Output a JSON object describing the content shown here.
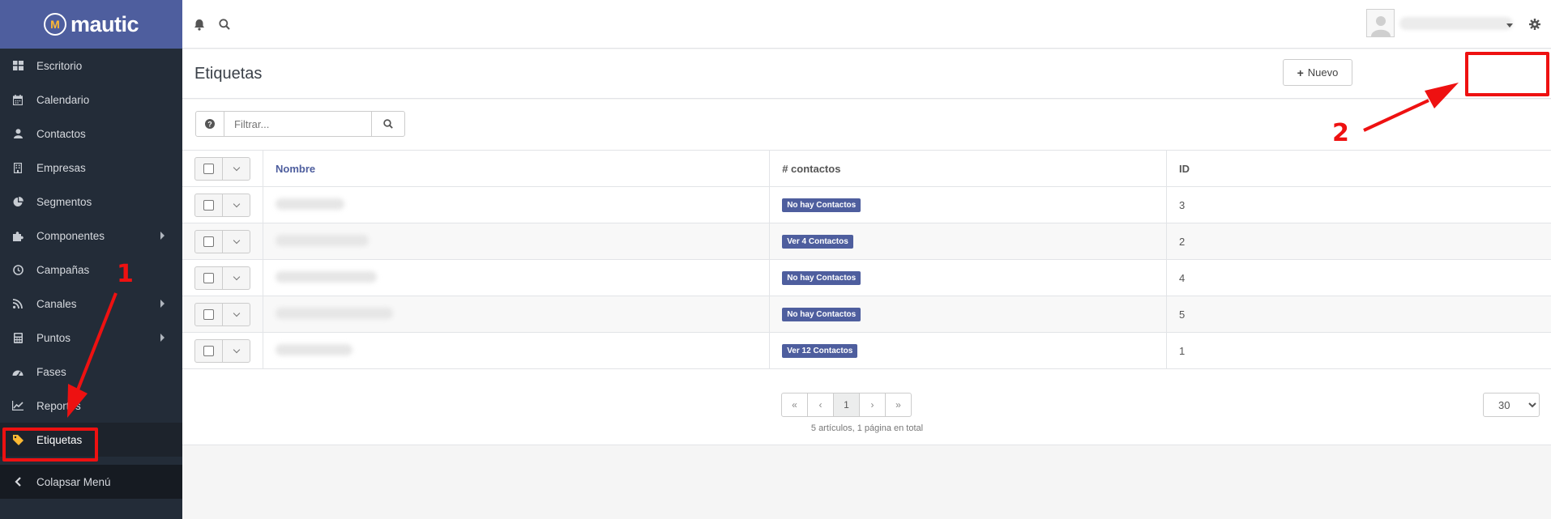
{
  "brand": {
    "name": "mautic",
    "logo_letter": "M",
    "accent": "#4e5e9e",
    "logo_accent": "#fdb933"
  },
  "sidebar": {
    "items": [
      {
        "label": "Escritorio",
        "icon": "dashboard-icon"
      },
      {
        "label": "Calendario",
        "icon": "calendar-icon"
      },
      {
        "label": "Contactos",
        "icon": "user-icon"
      },
      {
        "label": "Empresas",
        "icon": "building-icon"
      },
      {
        "label": "Segmentos",
        "icon": "pie-chart-icon"
      },
      {
        "label": "Componentes",
        "icon": "puzzle-icon",
        "submenu": true
      },
      {
        "label": "Campañas",
        "icon": "clock-icon"
      },
      {
        "label": "Canales",
        "icon": "rss-icon",
        "submenu": true
      },
      {
        "label": "Puntos",
        "icon": "calculator-icon",
        "submenu": true
      },
      {
        "label": "Fases",
        "icon": "tachometer-icon"
      },
      {
        "label": "Reportes",
        "icon": "line-chart-icon"
      },
      {
        "label": "Etiquetas",
        "icon": "tag-icon",
        "active": true
      }
    ],
    "collapse_label": "Colapsar Menú"
  },
  "header": {
    "title": "Etiquetas",
    "new_button": "Nuevo"
  },
  "filter": {
    "placeholder": "Filtrar..."
  },
  "table": {
    "columns": [
      "Nombre",
      "# contactos",
      "ID"
    ],
    "rows": [
      {
        "contacts": "No hay Contactos",
        "id": "3"
      },
      {
        "contacts": "Ver 4 Contactos",
        "id": "2"
      },
      {
        "contacts": "No hay Contactos",
        "id": "4"
      },
      {
        "contacts": "No hay Contactos",
        "id": "5"
      },
      {
        "contacts": "Ver 12 Contactos",
        "id": "1"
      }
    ]
  },
  "pagination": {
    "first": "«",
    "prev": "‹",
    "current": "1",
    "next": "›",
    "last": "»",
    "summary": "5 artículos, 1 página en total",
    "limit": "30"
  },
  "annotations": {
    "step1": "1",
    "step2": "2",
    "color": "#ee1111"
  }
}
